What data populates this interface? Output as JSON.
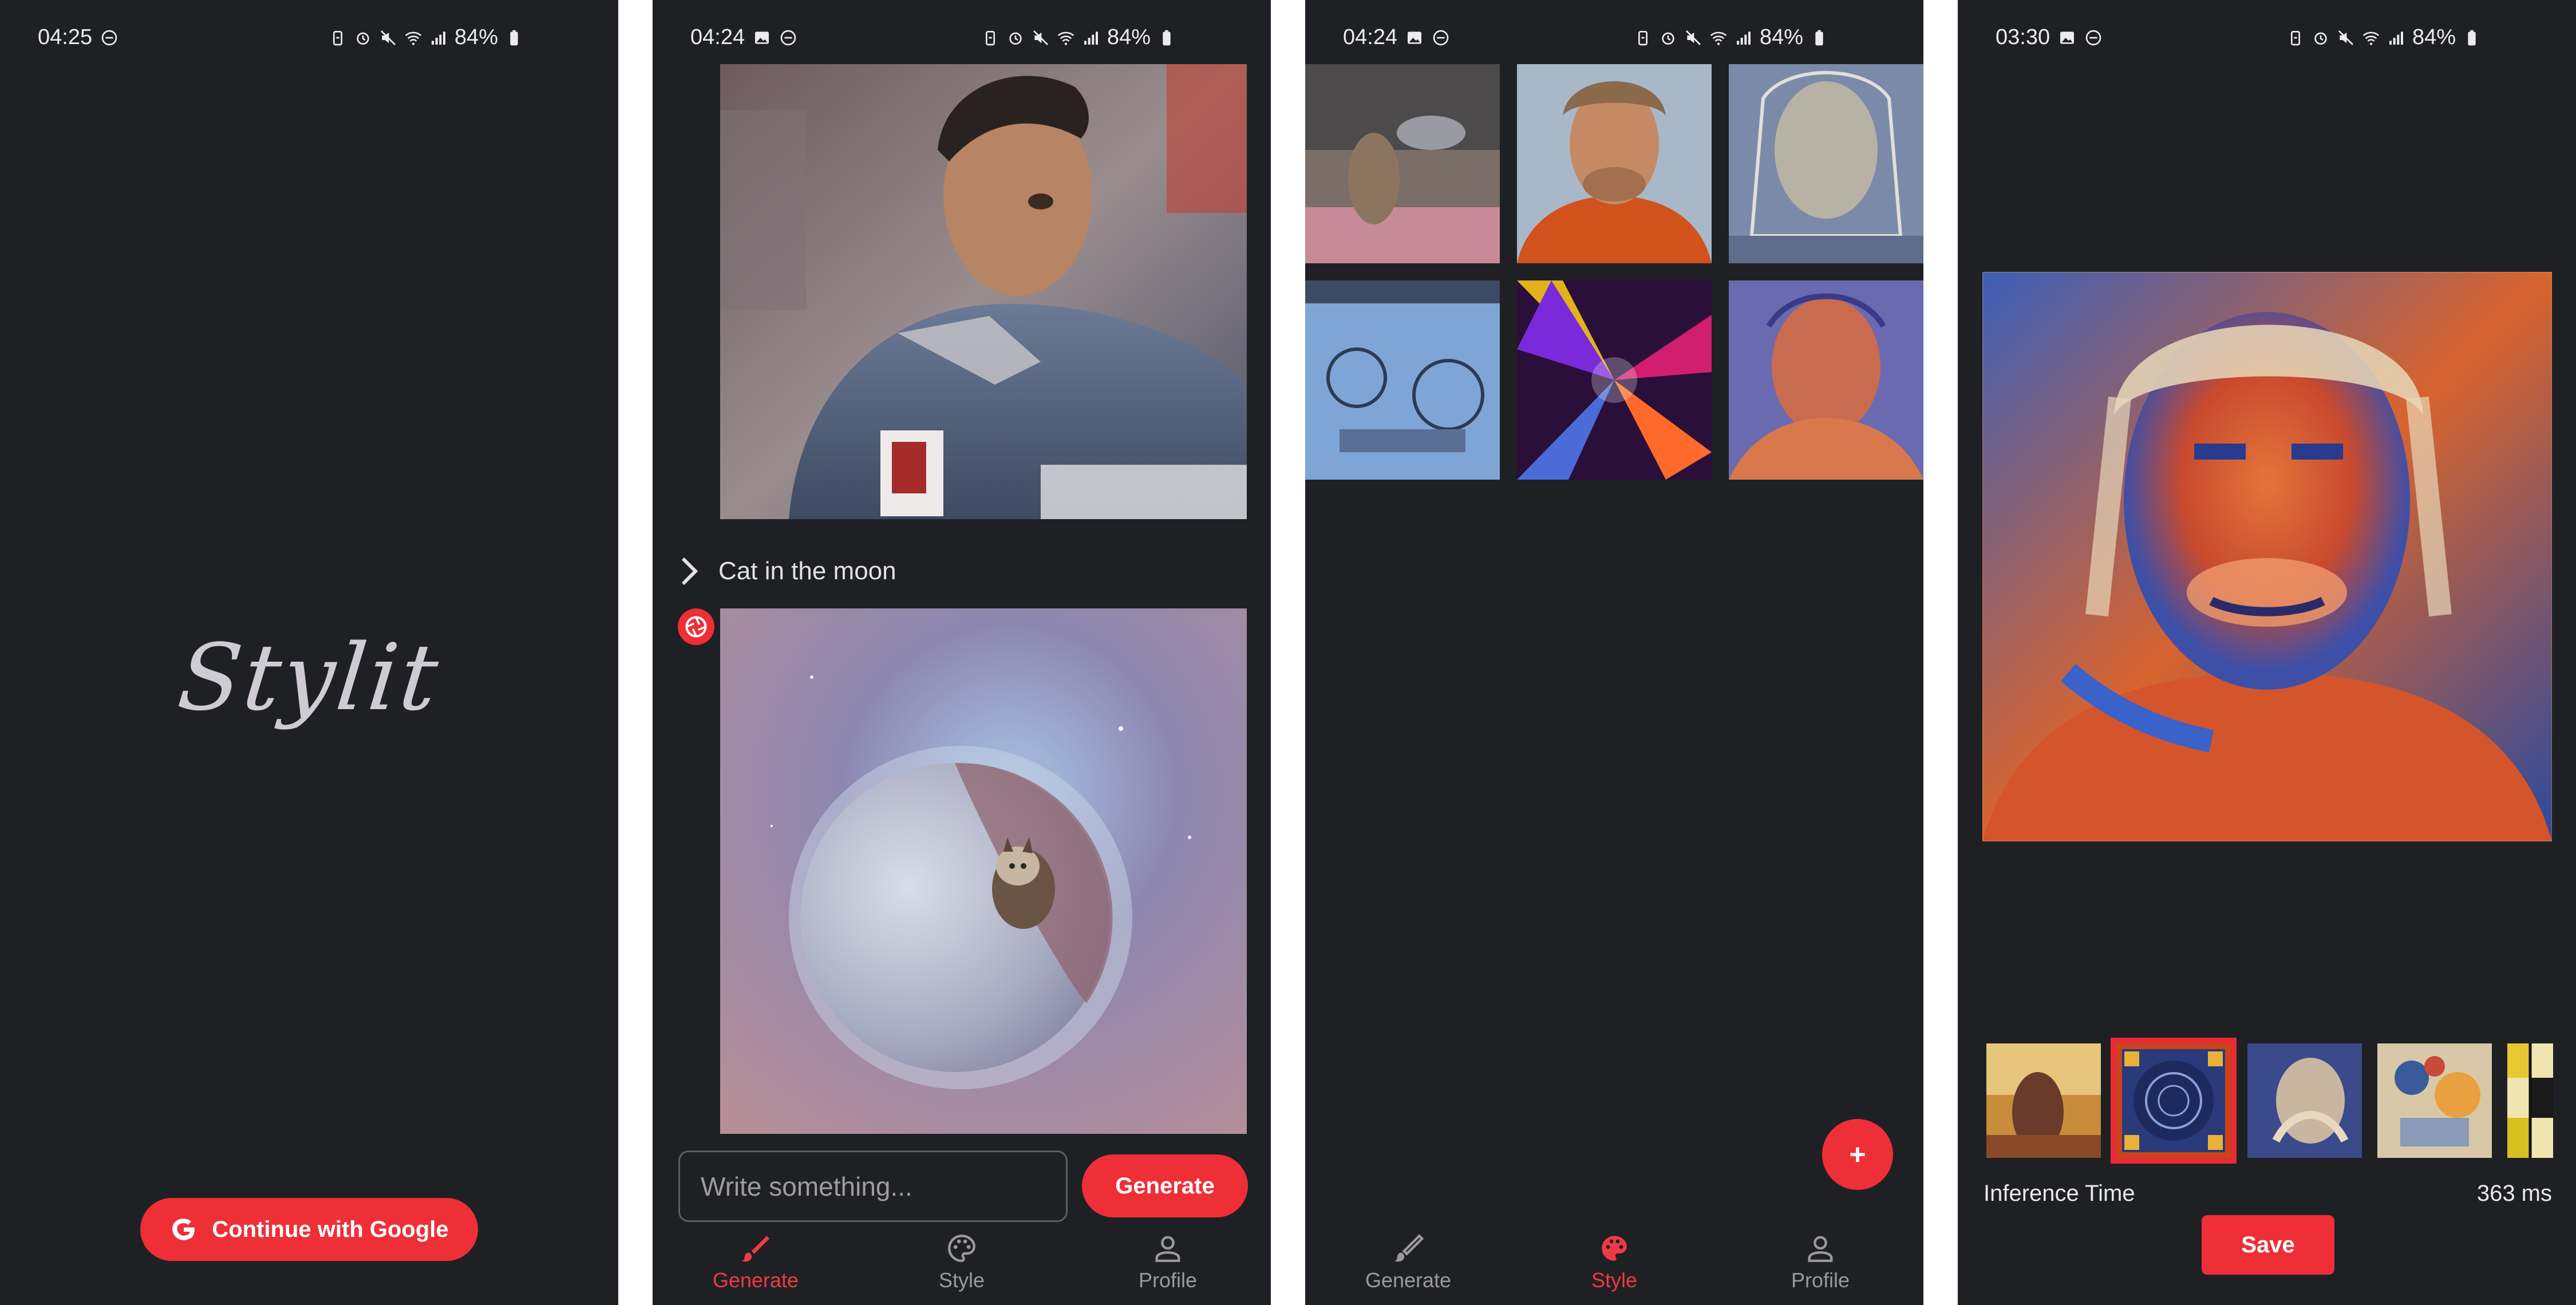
{
  "screens": [
    {
      "status": {
        "time": "04:25",
        "battery": "84%"
      },
      "app_name": "Stylit",
      "google_button_label": "Continue with Google"
    },
    {
      "status": {
        "time": "04:24",
        "battery": "84%"
      },
      "prompt_text": "Cat in the moon",
      "input_placeholder": "Write something...",
      "generate_button": "Generate",
      "nav": {
        "generate": "Generate",
        "style": "Style",
        "profile": "Profile",
        "active": "generate"
      }
    },
    {
      "status": {
        "time": "04:24",
        "battery": "84%"
      },
      "fab_label": "+",
      "nav": {
        "generate": "Generate",
        "style": "Style",
        "profile": "Profile",
        "active": "style"
      }
    },
    {
      "status": {
        "time": "03:30",
        "battery": "84%"
      },
      "inference_label": "Inference Time",
      "inference_value": "363 ms",
      "save_button": "Save",
      "selected_style_index": 1
    }
  ],
  "colors": {
    "background": "#1f2024",
    "accent": "#ee2f38",
    "nav_inactive": "#9a9a9e",
    "text": "#e9e9e9"
  },
  "icons": [
    "dnd-icon",
    "image-icon",
    "battery-saver-icon",
    "alarm-icon",
    "mute-icon",
    "wifi-icon",
    "signal-icon",
    "battery-icon",
    "google-icon",
    "chevron-right-icon",
    "shutter-icon",
    "brush-icon",
    "palette-icon",
    "person-icon",
    "plus-icon"
  ]
}
